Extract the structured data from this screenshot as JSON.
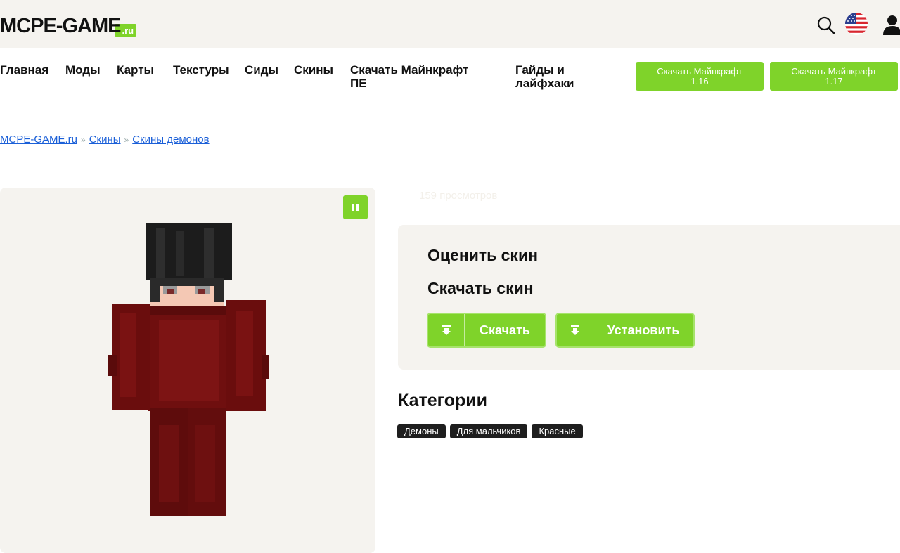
{
  "header": {
    "logo_main": "MCPE-GAME",
    "logo_tld": ".ru",
    "icons": [
      "search-icon",
      "us-flag-icon",
      "user-icon"
    ]
  },
  "nav": {
    "items": [
      {
        "label": "Главная"
      },
      {
        "label": "Моды"
      },
      {
        "label": "Карты"
      },
      {
        "label": "Текстуры"
      },
      {
        "label": "Сиды"
      },
      {
        "label": "Скины"
      },
      {
        "label_line1": "Скачать Майнкрафт",
        "label_line2": "ПЕ"
      },
      {
        "label_line1": "Гайды и",
        "label_line2": "лайфхаки"
      }
    ],
    "download_buttons": [
      {
        "line1": "Скачать Майнкрафт",
        "line2": "1.16"
      },
      {
        "line1": "Скачать Майнкрафт",
        "line2": "1.17"
      }
    ]
  },
  "breadcrumb": {
    "items": [
      "MCPE-GAME.ru",
      "Скины",
      "Скины демонов"
    ],
    "separator": "»"
  },
  "skin": {
    "views": "159 просмотров"
  },
  "panel": {
    "rate_title": "Оценить скин",
    "download_title": "Скачать скин",
    "download_label": "Скачать",
    "install_label": "Установить"
  },
  "categories": {
    "title": "Категории",
    "tags": [
      "Демоны",
      "Для мальчиков",
      "Красные"
    ]
  },
  "colors": {
    "accent": "#7fd32a",
    "link": "#1a5fd8",
    "header_bg": "#f5f3ef",
    "tag_bg": "#1e1e1e",
    "skin_red": "#7a1010"
  }
}
